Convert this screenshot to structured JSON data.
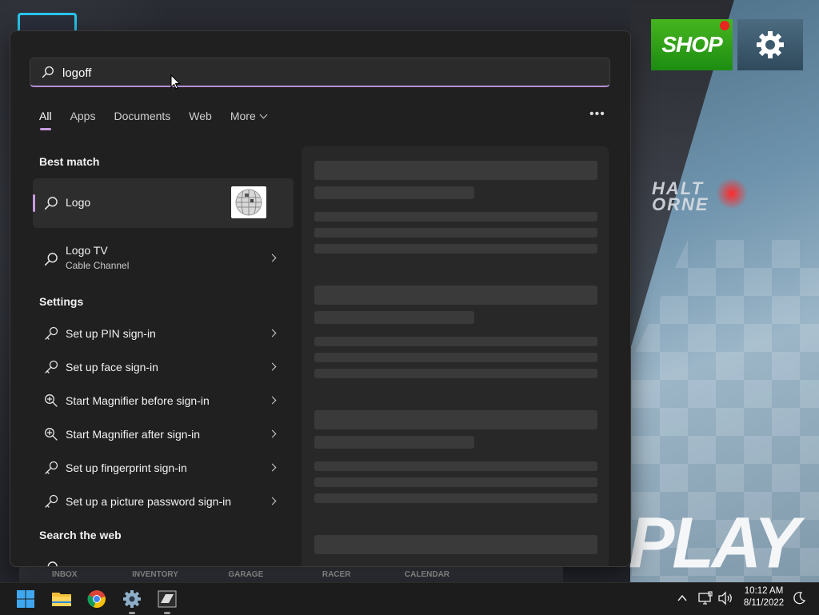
{
  "background": {
    "shop_label": "SHOP",
    "side_text": "HALT\nORNE",
    "play_label": "PLAY",
    "bottom_nav": [
      "INBOX",
      "INVENTORY",
      "GARAGE",
      "RACER",
      "CALENDAR",
      ""
    ]
  },
  "search": {
    "query": "logoff",
    "tabs": [
      {
        "label": "All",
        "active": true
      },
      {
        "label": "Apps"
      },
      {
        "label": "Documents"
      },
      {
        "label": "Web"
      },
      {
        "label": "More"
      }
    ],
    "more_options_icon": "ellipsis-icon"
  },
  "best_match": {
    "heading": "Best match",
    "item": {
      "title": "Logo",
      "icon": "search-icon",
      "thumbnail": "wikipedia-globe"
    }
  },
  "results": [
    {
      "title": "Logo TV",
      "subtitle": "Cable Channel",
      "icon": "search-icon"
    }
  ],
  "settings": {
    "heading": "Settings",
    "items": [
      {
        "label": "Set up PIN sign-in",
        "icon": "key-icon"
      },
      {
        "label": "Set up face sign-in",
        "icon": "key-icon"
      },
      {
        "label": "Start Magnifier before sign-in",
        "icon": "magnifier-icon"
      },
      {
        "label": "Start Magnifier after sign-in",
        "icon": "magnifier-icon"
      },
      {
        "label": "Set up fingerprint sign-in",
        "icon": "key-icon"
      },
      {
        "label": "Set up a picture password sign-in",
        "icon": "key-icon"
      }
    ]
  },
  "web": {
    "heading": "Search the web"
  },
  "taskbar": {
    "apps": [
      "windows-start-icon",
      "file-explorer-icon",
      "chrome-icon",
      "settings-gear-icon",
      "asphalt-game-icon"
    ],
    "time": "10:12 AM",
    "date": "8/11/2022"
  }
}
